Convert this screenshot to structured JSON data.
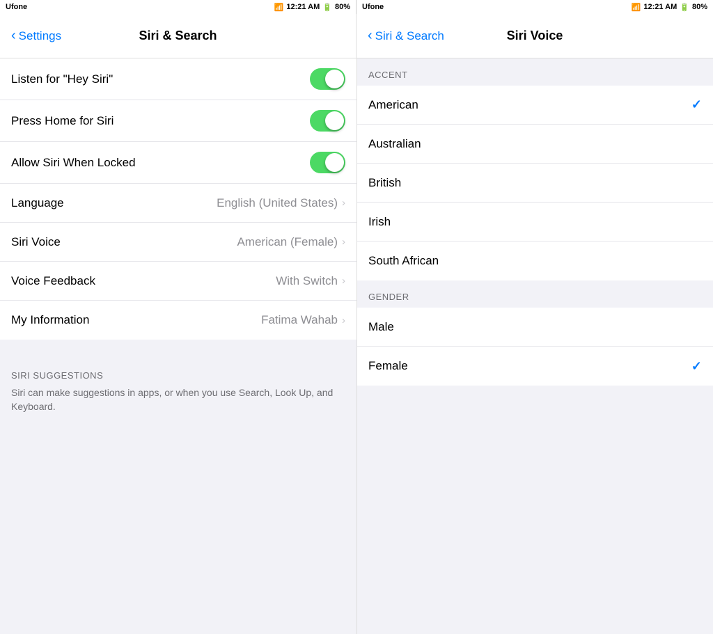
{
  "left_status": {
    "carrier": "Ufone",
    "time": "12:21 AM",
    "battery": "80%"
  },
  "right_status": {
    "carrier": "Ufone",
    "time": "12:21 AM",
    "battery": "80%"
  },
  "left_nav": {
    "back_label": "Settings",
    "title": "Siri & Search"
  },
  "right_nav": {
    "back_label": "Siri & Search",
    "title": "Siri Voice"
  },
  "settings_rows": [
    {
      "label": "Listen for \"Hey Siri\"",
      "type": "toggle",
      "value": true
    },
    {
      "label": "Press Home for Siri",
      "type": "toggle",
      "value": true
    },
    {
      "label": "Allow Siri When Locked",
      "type": "toggle",
      "value": true
    },
    {
      "label": "Language",
      "type": "value",
      "value": "English (United States)"
    },
    {
      "label": "Siri Voice",
      "type": "value",
      "value": "American (Female)"
    },
    {
      "label": "Voice Feedback",
      "type": "value",
      "value": "With Switch"
    },
    {
      "label": "My Information",
      "type": "value",
      "value": "Fatima Wahab"
    }
  ],
  "siri_suggestions": {
    "header": "SIRI SUGGESTIONS",
    "text": "Siri can make suggestions in apps, or when you use Search, Look Up, and Keyboard."
  },
  "accent_section": {
    "header": "ACCENT",
    "items": [
      {
        "label": "American",
        "selected": true
      },
      {
        "label": "Australian",
        "selected": false
      },
      {
        "label": "British",
        "selected": false
      },
      {
        "label": "Irish",
        "selected": false
      },
      {
        "label": "South African",
        "selected": false
      }
    ]
  },
  "gender_section": {
    "header": "GENDER",
    "items": [
      {
        "label": "Male",
        "selected": false
      },
      {
        "label": "Female",
        "selected": true
      }
    ]
  }
}
